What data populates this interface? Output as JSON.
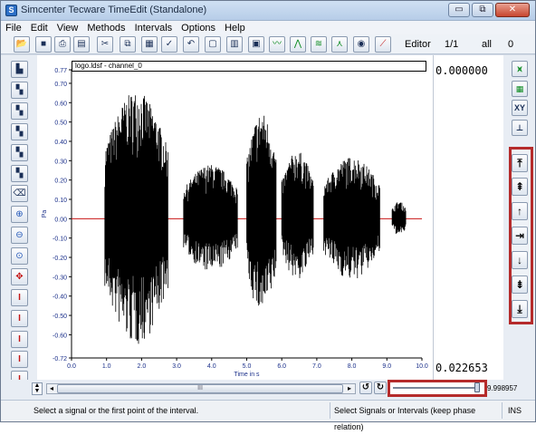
{
  "window": {
    "title": "Simcenter Tecware TimeEdit (Standalone)",
    "minimize": "▭",
    "restore": "⧉",
    "close": "✕"
  },
  "menu": [
    "File",
    "Edit",
    "View",
    "Methods",
    "Intervals",
    "Options",
    "Help"
  ],
  "toolbar": {
    "buttons": [
      {
        "icon": "open-icon",
        "glyph": "📂"
      },
      {
        "icon": "save-icon",
        "glyph": "■"
      },
      {
        "icon": "print-icon",
        "glyph": "⎙"
      },
      {
        "icon": "import-icon",
        "glyph": "▤"
      },
      {
        "icon": "cut-icon",
        "glyph": "✂"
      },
      {
        "icon": "copy-icon",
        "glyph": "⧉"
      },
      {
        "icon": "paste-icon",
        "glyph": "▦"
      },
      {
        "icon": "check-icon",
        "glyph": "✓"
      },
      {
        "icon": "undo-icon",
        "glyph": "↶"
      },
      {
        "icon": "document-icon",
        "glyph": "▢"
      },
      {
        "icon": "folder-chart-icon",
        "glyph": "▥"
      },
      {
        "icon": "save-chart-icon",
        "glyph": "▣"
      },
      {
        "icon": "waveform-icon",
        "glyph": "〰"
      },
      {
        "icon": "spectrum-icon",
        "glyph": "⋀"
      },
      {
        "icon": "multi-wave-icon",
        "glyph": "≋"
      },
      {
        "icon": "peak-icon",
        "glyph": "⋏"
      },
      {
        "icon": "zoom-chart-icon",
        "glyph": "◉"
      },
      {
        "icon": "marker-icon",
        "glyph": "⟋"
      }
    ],
    "mode_label": "Editor",
    "page": "1/1",
    "channel_select": "all",
    "counter": "0"
  },
  "left_toolbar": [
    {
      "icon": "select-signal-icon",
      "glyph": "▙"
    },
    {
      "icon": "signal-mark-icon",
      "glyph": "▚"
    },
    {
      "icon": "signal-range-icon",
      "glyph": "▚"
    },
    {
      "icon": "signal-shift-icon",
      "glyph": "▚"
    },
    {
      "icon": "signal-scale-icon",
      "glyph": "▚"
    },
    {
      "icon": "signal-copy-icon",
      "glyph": "▚"
    },
    {
      "icon": "eraser-icon",
      "glyph": "⌫"
    },
    {
      "icon": "zoom-in-icon",
      "glyph": "⊕"
    },
    {
      "icon": "zoom-out-icon",
      "glyph": "⊖"
    },
    {
      "icon": "zoom-fit-icon",
      "glyph": "⊙"
    },
    {
      "icon": "move-icon",
      "glyph": "✥"
    },
    {
      "icon": "interval-1-icon",
      "glyph": "I"
    },
    {
      "icon": "interval-2-icon",
      "glyph": "I"
    },
    {
      "icon": "interval-3-icon",
      "glyph": "I"
    },
    {
      "icon": "interval-4-icon",
      "glyph": "I"
    },
    {
      "icon": "interval-5-icon",
      "glyph": "I"
    },
    {
      "icon": "interval-6-icon",
      "glyph": "I"
    }
  ],
  "right_toolbar": [
    {
      "icon": "vibration-icon",
      "glyph": "⩙"
    },
    {
      "icon": "spectrum-green-icon",
      "glyph": "▦"
    },
    {
      "icon": "xy-icon",
      "glyph": "XY"
    },
    {
      "icon": "axis-scale-icon",
      "glyph": "⊥"
    }
  ],
  "nav_buttons": [
    {
      "name": "nav-first-button",
      "icon": "arrow-top-icon",
      "glyph": "⤒"
    },
    {
      "name": "nav-page-up-button",
      "icon": "double-arrow-up-icon",
      "glyph": "⇞"
    },
    {
      "name": "nav-up-button",
      "icon": "arrow-up-icon",
      "glyph": "↑"
    },
    {
      "name": "nav-jump-button",
      "icon": "arrow-jump-icon",
      "glyph": "⇥"
    },
    {
      "name": "nav-down-button",
      "icon": "arrow-down-icon",
      "glyph": "↓"
    },
    {
      "name": "nav-page-down-button",
      "icon": "double-arrow-down-icon",
      "glyph": "⇟"
    },
    {
      "name": "nav-last-button",
      "icon": "arrow-bottom-icon",
      "glyph": "⤓"
    }
  ],
  "plot": {
    "title": "logo.ldsf - channel_0",
    "value_top": "0.000000",
    "value_bottom": "0.022653"
  },
  "chart_data": {
    "type": "line",
    "title": "logo.ldsf - channel_0",
    "xlabel": "Time in s",
    "ylabel": "Pa",
    "xlim": [
      0.0,
      10.0
    ],
    "ylim": [
      -0.72,
      0.77
    ],
    "x_ticks": [
      "0.0",
      "1.0",
      "2.0",
      "3.0",
      "4.0",
      "5.0",
      "6.0",
      "7.0",
      "8.0",
      "9.0",
      "10.0"
    ],
    "y_ticks": [
      "0.77",
      "0.70",
      "0.60",
      "0.50",
      "0.40",
      "0.30",
      "0.20",
      "0.10",
      "0.00",
      "-0.10",
      "-0.20",
      "-0.30",
      "-0.40",
      "-0.50",
      "-0.60",
      "-0.72"
    ],
    "series": [
      {
        "color": "#000000",
        "segments": [
          {
            "x_start": 0.95,
            "x_end": 2.75,
            "amplitude_max": 0.66,
            "amplitude_min": -0.66
          },
          {
            "x_start": 3.2,
            "x_end": 4.75,
            "amplitude_max": 0.28,
            "amplitude_min": -0.28
          },
          {
            "x_start": 5.0,
            "x_end": 5.85,
            "amplitude_max": 0.55,
            "amplitude_min": -0.5
          },
          {
            "x_start": 6.0,
            "x_end": 6.9,
            "amplitude_max": 0.35,
            "amplitude_min": -0.32
          },
          {
            "x_start": 7.2,
            "x_end": 8.8,
            "amplitude_max": 0.32,
            "amplitude_min": -0.32
          },
          {
            "x_start": 9.15,
            "x_end": 9.55,
            "amplitude_max": 0.09,
            "amplitude_min": -0.09
          }
        ]
      }
    ],
    "zero_line_color": "#c81414",
    "grid": false
  },
  "bottom": {
    "scroll_center": "III",
    "slider_value": 1.0,
    "slider_label": "9.998957"
  },
  "status": {
    "hint": "Select a signal or the first point of the interval.",
    "mode": "Select Signals or Intervals (keep phase relation)",
    "ins": "INS"
  },
  "colors": {
    "highlight_border": "#b52b2b",
    "waveform": "#000000",
    "zero_line": "#c81414"
  }
}
